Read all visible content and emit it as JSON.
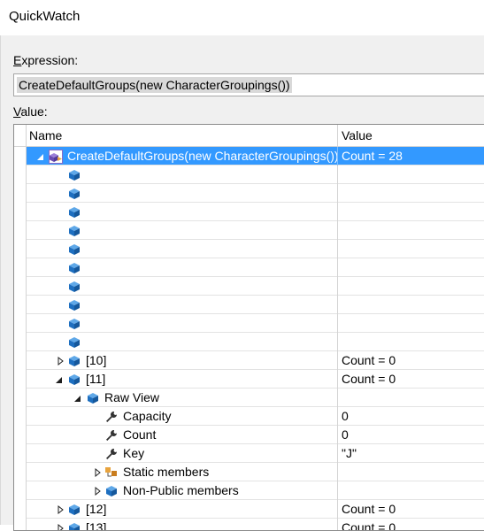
{
  "window": {
    "title": "QuickWatch"
  },
  "expression": {
    "label": "Expression:",
    "value": "CreateDefaultGroups(new CharacterGroupings())"
  },
  "value_label": "Value:",
  "grid": {
    "columns": {
      "name": "Name",
      "value": "Value"
    },
    "rows": [
      {
        "level": 0,
        "expander": "expanded",
        "icon": "method-group-icon",
        "name": "CreateDefaultGroups(new CharacterGroupings())",
        "value": "Count = 28",
        "selected": true
      },
      {
        "level": 1,
        "expander": "none",
        "icon": "object-icon",
        "name": "",
        "value": ""
      },
      {
        "level": 1,
        "expander": "none",
        "icon": "object-icon",
        "name": "",
        "value": ""
      },
      {
        "level": 1,
        "expander": "none",
        "icon": "object-icon",
        "name": "",
        "value": ""
      },
      {
        "level": 1,
        "expander": "none",
        "icon": "object-icon",
        "name": "",
        "value": ""
      },
      {
        "level": 1,
        "expander": "none",
        "icon": "object-icon",
        "name": "",
        "value": ""
      },
      {
        "level": 1,
        "expander": "none",
        "icon": "object-icon",
        "name": "",
        "value": ""
      },
      {
        "level": 1,
        "expander": "none",
        "icon": "object-icon",
        "name": "",
        "value": ""
      },
      {
        "level": 1,
        "expander": "none",
        "icon": "object-icon",
        "name": "",
        "value": ""
      },
      {
        "level": 1,
        "expander": "none",
        "icon": "object-icon",
        "name": "",
        "value": ""
      },
      {
        "level": 1,
        "expander": "none",
        "icon": "object-icon",
        "name": "",
        "value": ""
      },
      {
        "level": 1,
        "expander": "collapsed",
        "icon": "object-icon",
        "name": "[10]",
        "value": "Count = 0"
      },
      {
        "level": 1,
        "expander": "expanded",
        "icon": "object-icon",
        "name": "[11]",
        "value": "Count = 0"
      },
      {
        "level": 2,
        "expander": "expanded",
        "icon": "object-icon",
        "name": "Raw View",
        "value": ""
      },
      {
        "level": 3,
        "expander": "none",
        "icon": "wrench-icon",
        "name": "Capacity",
        "value": "0"
      },
      {
        "level": 3,
        "expander": "none",
        "icon": "wrench-icon",
        "name": "Count",
        "value": "0"
      },
      {
        "level": 3,
        "expander": "none",
        "icon": "wrench-icon",
        "name": "Key",
        "value": "\"J\""
      },
      {
        "level": 3,
        "expander": "collapsed",
        "icon": "static-members-icon",
        "name": "Static members",
        "value": ""
      },
      {
        "level": 3,
        "expander": "collapsed",
        "icon": "object-icon",
        "name": "Non-Public members",
        "value": ""
      },
      {
        "level": 1,
        "expander": "collapsed",
        "icon": "object-icon",
        "name": "[12]",
        "value": "Count = 0"
      },
      {
        "level": 1,
        "expander": "collapsed",
        "icon": "object-icon",
        "name": "[13]",
        "value": "Count = 0"
      }
    ]
  },
  "colors": {
    "selection": "#3399ff",
    "object_icon": "#1e6fc0",
    "static_icon": "#e8a33d",
    "grid_line": "#e3e3e3"
  }
}
